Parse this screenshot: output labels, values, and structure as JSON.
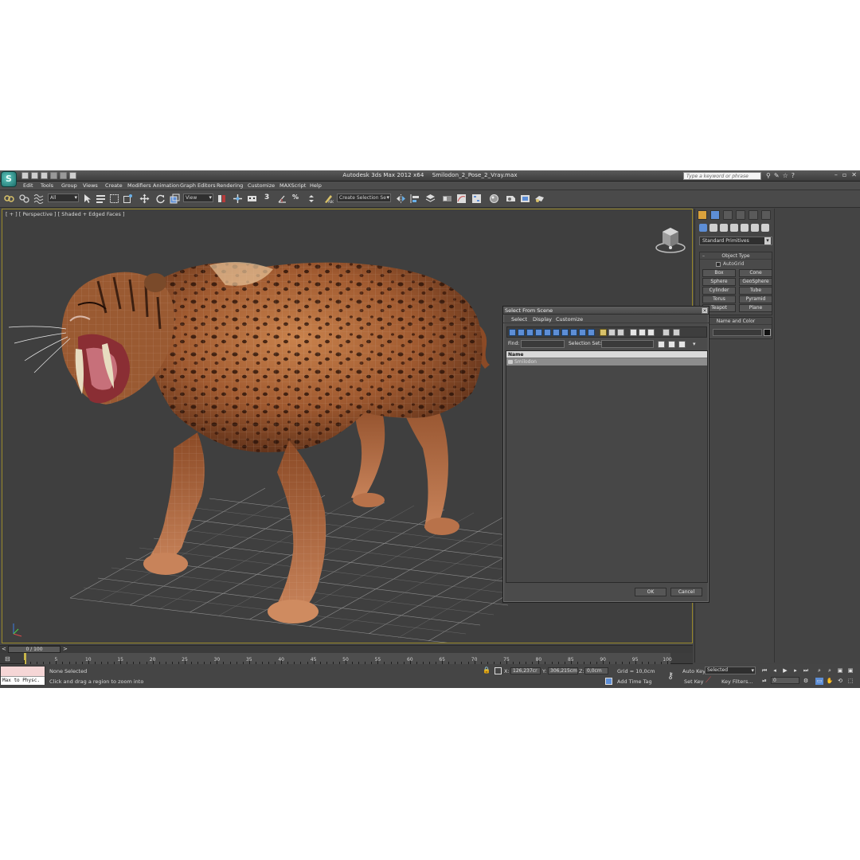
{
  "titlebar": {
    "logo": "3ds Max logo",
    "app_title": "Autodesk 3ds Max 2012 x64",
    "file_name": "Smilodon_2_Pose_2_Vray.max",
    "search_placeholder": "Type a keyword or phrase",
    "icons": [
      "binoculars-icon",
      "star-icon",
      "favorites-icon",
      "help-icon"
    ]
  },
  "menu": [
    "Edit",
    "Tools",
    "Group",
    "Views",
    "Create",
    "Modifiers",
    "Animation",
    "Graph Editors",
    "Rendering",
    "Customize",
    "MAXScript",
    "Help"
  ],
  "toolbar": {
    "selection_filter": "All",
    "reference_coord": "View",
    "named_selection_placeholder": "Create Selection Se",
    "snap_label": "3"
  },
  "viewport": {
    "label": "[ + ] [ Perspective ] [ Shaded + Edged Faces ]",
    "active_border": "#c8b64a",
    "background": "#3f3f3f"
  },
  "command_panel": {
    "category": "Standard Primitives",
    "object_type_title": "Object Type",
    "autogrid_label": "AutoGrid",
    "primitives": [
      "Box",
      "Cone",
      "Sphere",
      "GeoSphere",
      "Cylinder",
      "Tube",
      "Torus",
      "Pyramid",
      "Teapot",
      "Plane"
    ],
    "name_color_title": "Name and Color"
  },
  "dialog": {
    "title": "Select From Scene",
    "menu": [
      "Select",
      "Display",
      "Customize"
    ],
    "find_label": "Find:",
    "selection_set_label": "Selection Set:",
    "column_name": "Name",
    "rows": [
      "Smilodon"
    ],
    "ok_label": "OK",
    "cancel_label": "Cancel"
  },
  "timeline": {
    "frame_display": "0 / 100",
    "ticks": [
      5,
      10,
      15,
      20,
      25,
      30,
      35,
      40,
      45,
      50,
      55,
      60,
      65,
      70,
      75,
      80,
      85,
      90,
      95,
      100
    ],
    "current_frame": 0,
    "total_frames": 100
  },
  "status": {
    "maxscript_text": "Max to Physc.",
    "selection_status": "None Selected",
    "prompt": "Click and drag a region to zoom into",
    "x_label": "X:",
    "x_value": "126,237cr",
    "y_label": "Y:",
    "y_value": "306,215cm",
    "z_label": "Z:",
    "z_value": "0,0cm",
    "grid": "Grid = 10,0cm",
    "add_time_tag": "Add Time Tag",
    "auto_key": "Auto Key",
    "set_key": "Set Key",
    "key_mode": "Selected",
    "key_filters": "Key Filters...",
    "frame_field": "0"
  }
}
